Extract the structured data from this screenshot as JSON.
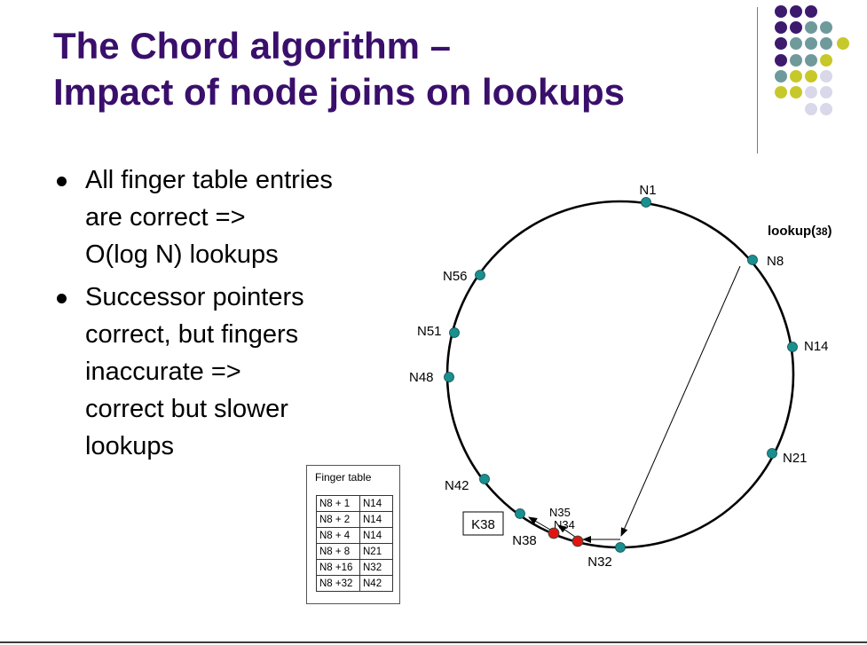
{
  "title": {
    "line1": "The Chord algorithm –",
    "line2": "Impact of node joins on lookups"
  },
  "bullets": [
    {
      "lines": [
        "All finger table entries",
        "are correct =>",
        "O(log N) lookups"
      ]
    },
    {
      "lines": [
        "Successor pointers",
        "correct, but fingers",
        "inaccurate =>",
        "correct but slower",
        "lookups"
      ]
    }
  ],
  "finger_table": {
    "title": "Finger table",
    "rows": [
      {
        "key": "N8 + 1",
        "node": "N14"
      },
      {
        "key": "N8 + 2",
        "node": "N14"
      },
      {
        "key": "N8 + 4",
        "node": "N14"
      },
      {
        "key": "N8 + 8",
        "node": "N21"
      },
      {
        "key": "N8 +16",
        "node": "N32"
      },
      {
        "key": "N8 +32",
        "node": "N42"
      }
    ]
  },
  "ring": {
    "nodes": [
      {
        "label": "N1",
        "status": "existing"
      },
      {
        "label": "N8",
        "status": "existing"
      },
      {
        "label": "N14",
        "status": "existing"
      },
      {
        "label": "N21",
        "status": "existing"
      },
      {
        "label": "N32",
        "status": "existing"
      },
      {
        "label": "N34",
        "status": "joined"
      },
      {
        "label": "N35",
        "status": "joined"
      },
      {
        "label": "N38",
        "status": "existing"
      },
      {
        "label": "N42",
        "status": "existing"
      },
      {
        "label": "N48",
        "status": "existing"
      },
      {
        "label": "N51",
        "status": "existing"
      },
      {
        "label": "N56",
        "status": "existing"
      }
    ],
    "lookup_prefix": "lookup(",
    "lookup_key": "38",
    "lookup_suffix": ")",
    "key_box": "K38",
    "colors": {
      "existing": "#1a8f8f",
      "joined": "#e0160e",
      "ring": "#000000"
    }
  },
  "decoration_colors": {
    "purple": "#3e1a6e",
    "teal": "#6f9a9c",
    "olive": "#c7c82a",
    "lavender": "#d9d8ea"
  }
}
